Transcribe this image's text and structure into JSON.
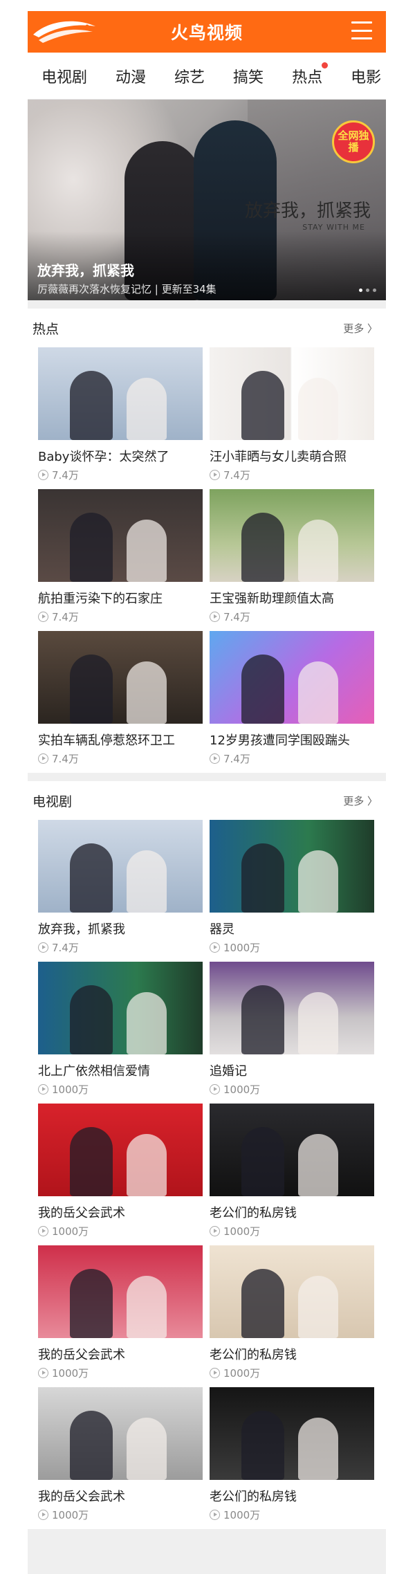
{
  "header": {
    "title": "火鸟视频",
    "logo_icon": "firebird-logo-icon",
    "menu_icon": "hamburger-menu-icon",
    "accent": "#ff6a13"
  },
  "nav": {
    "items": [
      {
        "label": "电视剧",
        "dot": false
      },
      {
        "label": "动漫",
        "dot": false
      },
      {
        "label": "综艺",
        "dot": false
      },
      {
        "label": "搞笑",
        "dot": false
      },
      {
        "label": "热点",
        "dot": true
      },
      {
        "label": "电影",
        "dot": false
      }
    ]
  },
  "banner": {
    "title": "放弃我，抓紧我",
    "subtitle": "厉薇薇再次落水恢复记忆 | 更新至34集",
    "badge": "全网独播",
    "poster_text": "放弃我，抓紧我",
    "poster_sub": "STAY WITH ME",
    "dot_count": 3
  },
  "hot": {
    "title": "热点",
    "more": "更多 〉",
    "items": [
      {
        "title": "Baby谈怀孕：太突然了",
        "views": "7.4万",
        "scene": "bg-wedding"
      },
      {
        "title": "汪小菲晒与女儿卖萌合照",
        "views": "7.4万",
        "scene": "bg-split"
      },
      {
        "title": "航拍重污染下的石家庄",
        "views": "7.4万",
        "scene": "bg-stage"
      },
      {
        "title": "王宝强新助理颜值太高",
        "views": "7.4万",
        "scene": "bg-outdoor"
      },
      {
        "title": "实拍车辆乱停惹怒环卫工",
        "views": "7.4万",
        "scene": "bg-studio"
      },
      {
        "title": "12岁男孩遭同学围殴踹头",
        "views": "7.4万",
        "scene": "bg-purple"
      }
    ]
  },
  "tv": {
    "title": "电视剧",
    "more": "更多 〉",
    "items": [
      {
        "title": "放弃我，抓紧我",
        "views": "7.4万",
        "scene": "bg-wedding"
      },
      {
        "title": "器灵",
        "views": "1000万",
        "scene": "bg-tv"
      },
      {
        "title": "北上广依然相信爱情",
        "views": "1000万",
        "scene": "bg-tv"
      },
      {
        "title": "追婚记",
        "views": "1000万",
        "scene": "bg-hall"
      },
      {
        "title": "我的岳父会武术",
        "views": "1000万",
        "scene": "bg-red"
      },
      {
        "title": "老公们的私房钱",
        "views": "1000万",
        "scene": "bg-dark"
      },
      {
        "title": "我的岳父会武术",
        "views": "1000万",
        "scene": "bg-pink"
      },
      {
        "title": "老公们的私房钱",
        "views": "1000万",
        "scene": "bg-cream"
      },
      {
        "title": "我的岳父会武术",
        "views": "1000万",
        "scene": "bg-grey"
      },
      {
        "title": "老公们的私房钱",
        "views": "1000万",
        "scene": "bg-night"
      }
    ]
  }
}
